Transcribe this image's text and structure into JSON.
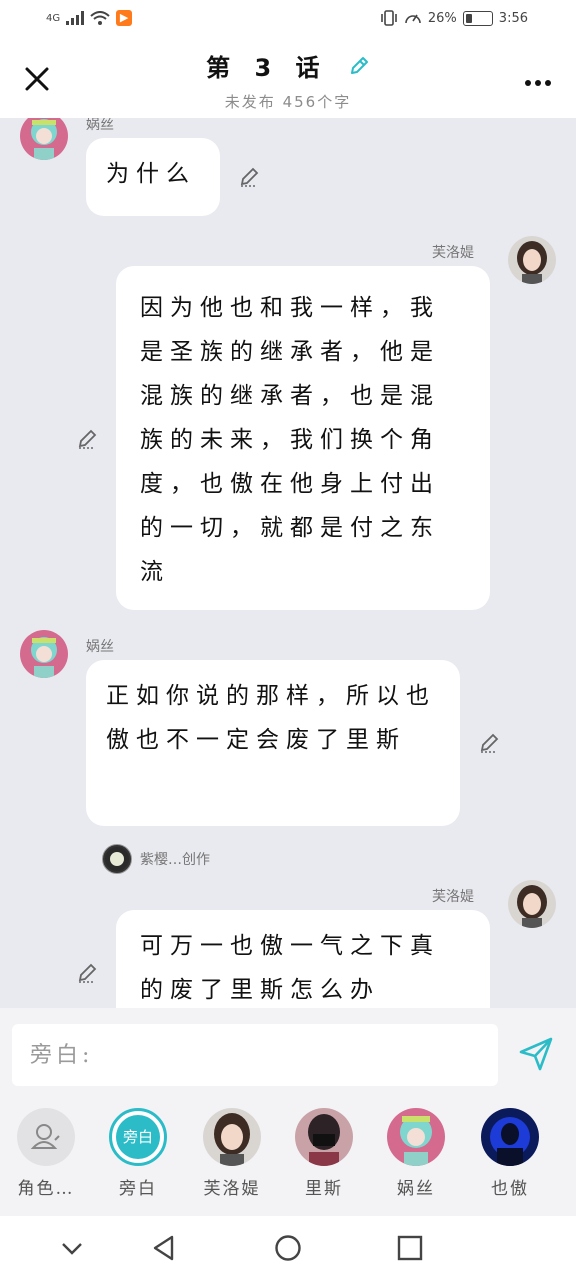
{
  "status_bar": {
    "network": "4G",
    "app_badge": "▶",
    "battery_percent": "26%",
    "battery_level": 0.26,
    "time": "3:56"
  },
  "header": {
    "title": "第 3 话",
    "subtitle": "未发布 456个字"
  },
  "messages": [
    {
      "speaker": "娲丝",
      "side": "left",
      "text": "为什么"
    },
    {
      "speaker": "芙洛媞",
      "side": "right",
      "text": "因为他也和我一样，我是圣族的继承者，他是混族的继承者，也是混族的未来，我们换个角度，也傲在他身上付出的一切，就都是付之东流"
    },
    {
      "speaker": "娲丝",
      "side": "left",
      "text": "正如你说的那样，所以也傲也不一定会废了里斯"
    },
    {
      "speaker": "芙洛媞",
      "side": "right",
      "text": "可万一也傲一气之下真的废了里斯怎么办"
    }
  ],
  "creator_note": "紫樱…创作",
  "input": {
    "placeholder": "旁白:"
  },
  "characters": [
    {
      "label": "角色…"
    },
    {
      "label": "旁白",
      "circle_text": "旁白"
    },
    {
      "label": "芙洛媞"
    },
    {
      "label": "里斯"
    },
    {
      "label": "娲丝"
    },
    {
      "label": "也傲"
    }
  ],
  "colors": {
    "accent": "#2bbcc8",
    "chat_background": "#e9eaef",
    "app_badge": "#ff7a1a"
  }
}
